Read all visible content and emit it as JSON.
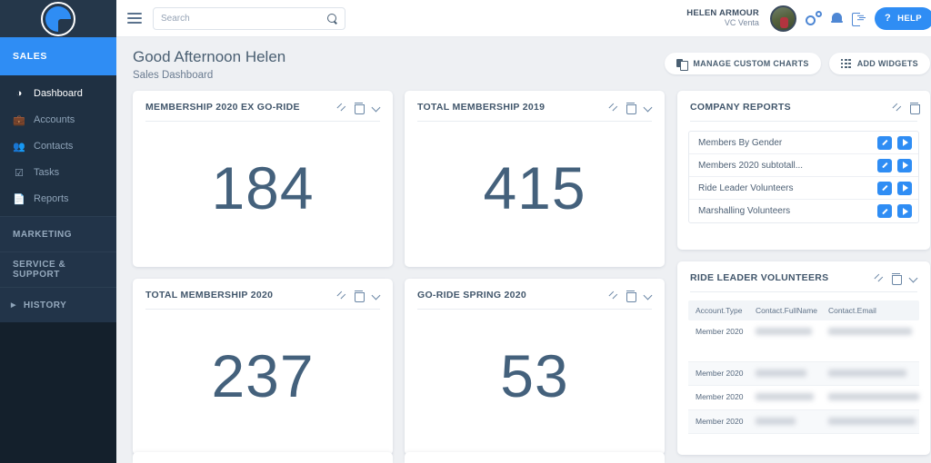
{
  "brand": {
    "logo_icon": "pie-chart-logo",
    "accent_color": "#2f8df4",
    "sidebar_color": "#1f3042"
  },
  "sidebar": {
    "active_section": "SALES",
    "items": [
      {
        "label": "Dashboard",
        "icon": "speedometer-icon",
        "active": true
      },
      {
        "label": "Accounts",
        "icon": "briefcase-icon",
        "active": false
      },
      {
        "label": "Contacts",
        "icon": "people-icon",
        "active": false
      },
      {
        "label": "Tasks",
        "icon": "checklist-icon",
        "active": false
      },
      {
        "label": "Reports",
        "icon": "document-icon",
        "active": false
      }
    ],
    "sections": [
      {
        "label": "MARKETING"
      },
      {
        "label": "SERVICE & SUPPORT"
      }
    ],
    "history": {
      "label": "HISTORY",
      "icon": "triangle-right-icon"
    }
  },
  "topbar": {
    "menu_icon": "hamburger-icon",
    "search": {
      "placeholder": "Search",
      "value": "",
      "icon": "search-icon"
    },
    "user": {
      "name": "HELEN ARMOUR",
      "org": "VC Venta",
      "avatar": "cyclist-avatar"
    },
    "icons": [
      "settings-gears-icon",
      "bell-icon",
      "logout-icon"
    ],
    "help_button": {
      "label": "HELP",
      "glyph": "?"
    }
  },
  "header": {
    "greeting": "Good Afternoon Helen",
    "subtitle": "Sales Dashboard",
    "actions": [
      {
        "label": "MANAGE CUSTOM CHARTS",
        "icon": "copy-charts-icon"
      },
      {
        "label": "ADD WIDGETS",
        "icon": "grid-icon"
      }
    ]
  },
  "kpi_cards": [
    {
      "title": "MEMBERSHIP 2020 EX GO-RIDE",
      "value": "184"
    },
    {
      "title": "TOTAL MEMBERSHIP 2019",
      "value": "415"
    },
    {
      "title": "TOTAL MEMBERSHIP 2020",
      "value": "237"
    },
    {
      "title": "GO-RIDE SPRING 2020",
      "value": "53"
    }
  ],
  "card_actions": {
    "expand": "expand-icon",
    "delete": "trash-icon",
    "collapse": "chevron-down-icon"
  },
  "company_reports": {
    "title": "COMPANY REPORTS",
    "rows": [
      {
        "name": "Members By Gender"
      },
      {
        "name": "Members 2020 subtotall..."
      },
      {
        "name": "Ride Leader Volunteers"
      },
      {
        "name": "Marshalling Volunteers"
      }
    ],
    "row_actions": {
      "edit": "pencil-icon",
      "run": "play-icon"
    }
  },
  "volunteers_table": {
    "title": "RIDE LEADER VOLUNTEERS",
    "columns": [
      "Account.Type",
      "Contact.FullName",
      "Contact.Email"
    ],
    "rows": [
      {
        "type": "Member 2020",
        "name": "",
        "email": ""
      },
      {
        "type": "Member 2020",
        "name": "",
        "email": ""
      },
      {
        "type": "Member 2020",
        "name": "",
        "email": ""
      },
      {
        "type": "Member 2020",
        "name": "",
        "email": ""
      }
    ]
  }
}
